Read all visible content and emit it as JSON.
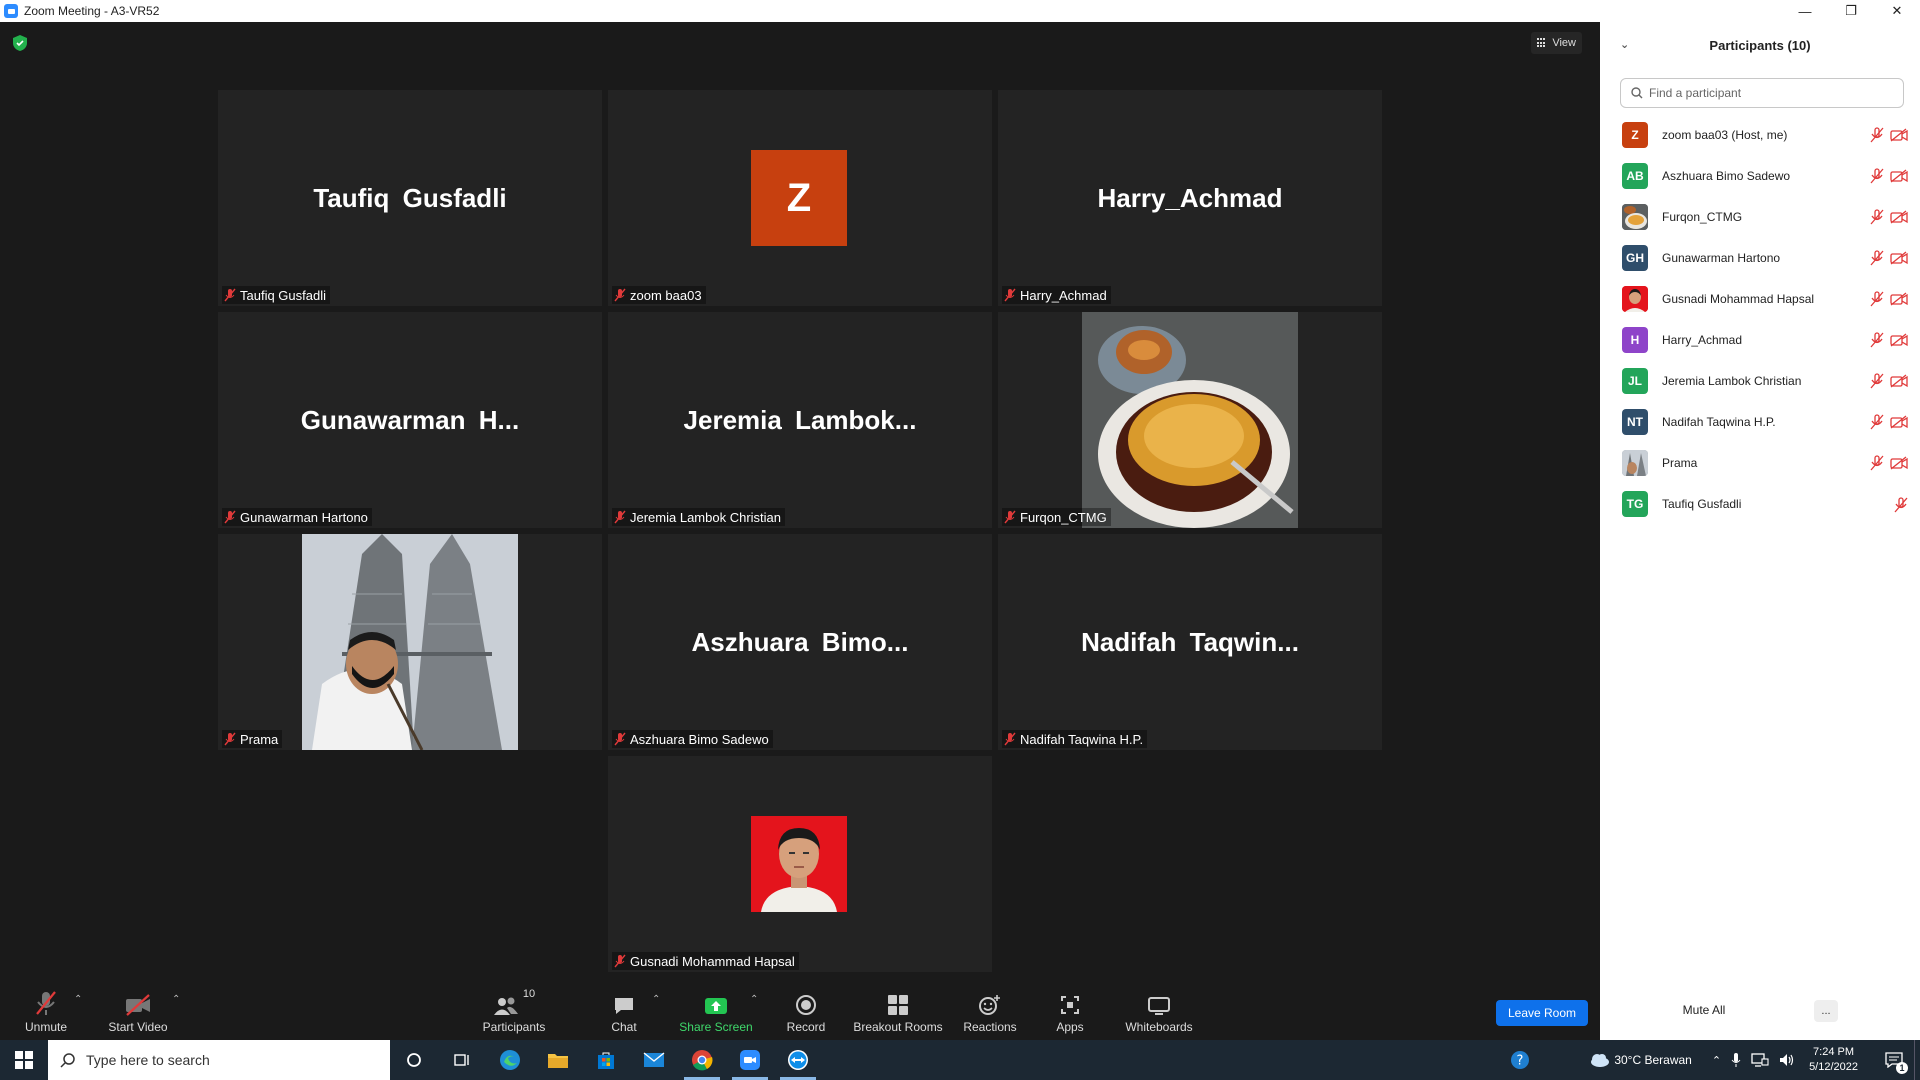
{
  "window": {
    "title": "Zoom Meeting - A3-VR52"
  },
  "meeting": {
    "view_label": "View",
    "tiles": [
      {
        "big": "Taufiq Gusfadli",
        "label": "Taufiq Gusfadli"
      },
      {
        "avatar": "Z",
        "label": "zoom baa03"
      },
      {
        "big": "Harry_Achmad",
        "label": "Harry_Achmad"
      },
      {
        "big": "Gunawarman  H...",
        "label": "Gunawarman Hartono"
      },
      {
        "big": "Jeremia  Lambok...",
        "label": "Jeremia Lambok Christian"
      },
      {
        "photo": "creme-brulee-photo",
        "label": "Furqon_CTMG"
      },
      {
        "photo": "selfie-towers-photo",
        "label": "Prama"
      },
      {
        "big": "Aszhuara  Bimo...",
        "label": "Aszhuara Bimo Sadewo"
      },
      {
        "big": "Nadifah  Taqwin...",
        "label": "Nadifah Taqwina H.P."
      },
      {
        "photo": "portrait-red-background",
        "label": "Gusnadi Mohammad Hapsal"
      }
    ]
  },
  "toolbar": {
    "unmute": "Unmute",
    "start_video": "Start Video",
    "participants": "Participants",
    "participants_count": "10",
    "chat": "Chat",
    "share_screen": "Share Screen",
    "record": "Record",
    "breakout_rooms": "Breakout Rooms",
    "reactions": "Reactions",
    "apps": "Apps",
    "whiteboards": "Whiteboards",
    "leave": "Leave Room"
  },
  "panel": {
    "title": "Participants (10)",
    "search_placeholder": "Find a participant",
    "participants": [
      {
        "initials": "Z",
        "name": "zoom baa03 (Host, me)",
        "color": "#c7400f",
        "cam": true
      },
      {
        "initials": "AB",
        "name": "Aszhuara Bimo Sadewo",
        "color": "#23a55a",
        "cam": true
      },
      {
        "initials": "",
        "name": "Furqon_CTMG",
        "color": "#b5651d",
        "cam": true
      },
      {
        "initials": "GH",
        "name": "Gunawarman Hartono",
        "color": "#2f4e6b",
        "cam": true
      },
      {
        "initials": "",
        "name": "Gusnadi Mohammad Hapsal",
        "color": "#e02020",
        "cam": true
      },
      {
        "initials": "H",
        "name": "Harry_Achmad",
        "color": "#8e44c9",
        "cam": true
      },
      {
        "initials": "JL",
        "name": "Jeremia Lambok Christian",
        "color": "#23a55a",
        "cam": true
      },
      {
        "initials": "NT",
        "name": "Nadifah Taqwina H.P.",
        "color": "#2f4e6b",
        "cam": true
      },
      {
        "initials": "",
        "name": "Prama",
        "color": "#8a96a3",
        "cam": true
      },
      {
        "initials": "TG",
        "name": "Taufiq Gusfadli",
        "color": "#23a55a",
        "cam": false
      }
    ],
    "mute_all": "Mute All",
    "more": "..."
  },
  "taskbar": {
    "search_placeholder": "Type here to search",
    "weather": "30°C  Berawan",
    "time": "7:24 PM",
    "date": "5/12/2022"
  }
}
